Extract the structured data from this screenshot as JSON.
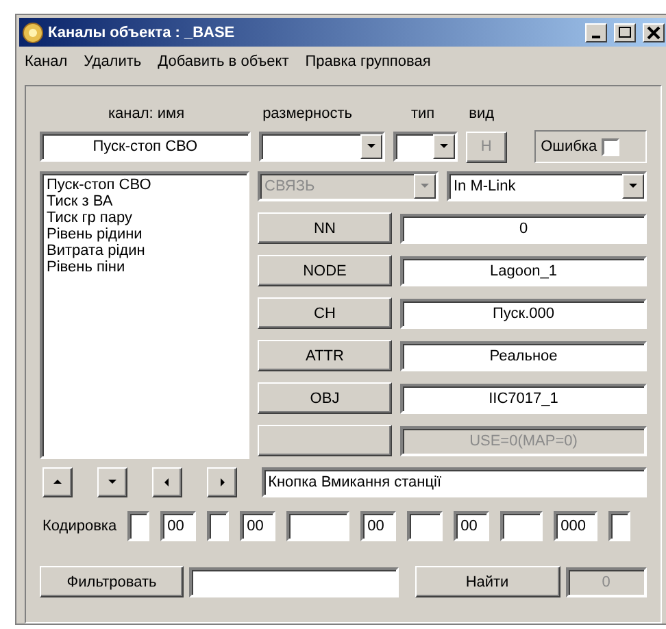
{
  "window": {
    "title": "Каналы объекта : _BASE"
  },
  "menu": [
    "Канал",
    "Удалить",
    "Добавить в объект",
    "Правка групповая"
  ],
  "header_labels": [
    "канал: имя",
    "размерность",
    "тип",
    "вид"
  ],
  "channel_name": {
    "value": "Пуск-стоп СВО"
  },
  "view_button": {
    "label": "H",
    "disabled": true
  },
  "error_checkbox": {
    "label": "Ошибка",
    "checked": false
  },
  "channels": [
    {
      "label": "Пуск-стоп СВО",
      "selected": false
    },
    {
      "label": "Тиск з ВА",
      "selected": false
    },
    {
      "label": "Тиск гр пару",
      "selected": false
    },
    {
      "label": "Рівень рідини",
      "selected": false
    },
    {
      "label": "Витрата рідин",
      "selected": false
    },
    {
      "label": "Рівень піни",
      "selected": false
    }
  ],
  "link_type": {
    "value": "СВЯЗЬ",
    "disabled": true
  },
  "link_mode": {
    "value": "In M-Link",
    "disabled": false
  },
  "address_rows": [
    {
      "button": "NN",
      "value": "0",
      "disabled": false
    },
    {
      "button": "NODE",
      "value": "Lagoon_1",
      "disabled": false
    },
    {
      "button": "CH",
      "value": "Пуск.000",
      "disabled": false
    },
    {
      "button": "ATTR",
      "value": "Реальное",
      "disabled": false
    },
    {
      "button": "OBJ",
      "value": "IIC7017_1",
      "disabled": false
    },
    {
      "value": "USE=0(MAP=0)",
      "disabled": true
    }
  ],
  "description": {
    "value": "Кнопка Вмикання станції"
  },
  "coding": {
    "label": "Кодировка",
    "fields": [
      {
        "kind": "blank"
      },
      {
        "kind": "value",
        "value": "00"
      },
      {
        "kind": "blank"
      },
      {
        "kind": "value",
        "value": "00"
      },
      {
        "kind": "blank"
      },
      {
        "kind": "value",
        "value": "00"
      },
      {
        "kind": "blank"
      },
      {
        "kind": "value",
        "value": "00"
      },
      {
        "kind": "blank"
      },
      {
        "kind": "value",
        "value": "000"
      },
      {
        "kind": "blank"
      }
    ]
  },
  "filter_button": "Фильтровать",
  "find_button": "Найти",
  "found_count": {
    "value": "0",
    "disabled": true
  }
}
